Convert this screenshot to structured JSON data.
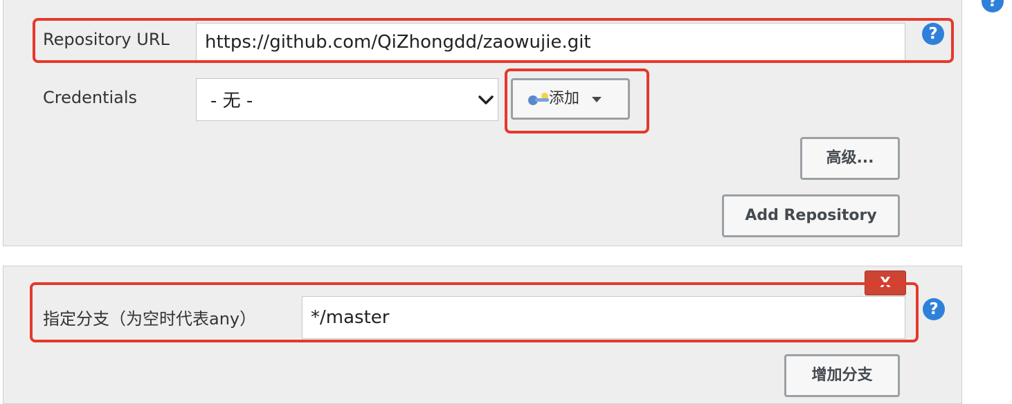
{
  "repository": {
    "url_label": "Repository URL",
    "url_value": "https://github.com/QiZhongdd/zaowujie.git",
    "credentials_label": "Credentials",
    "credentials_selected": "- 无 -",
    "add_button_label": "添加",
    "advanced_button_label": "高级...",
    "add_repository_label": "Add Repository"
  },
  "branch": {
    "label": "指定分支（为空时代表any）",
    "value": "*/master",
    "delete_label": "X",
    "add_branch_label": "增加分支"
  },
  "help": {
    "glyph": "?"
  },
  "colors": {
    "highlight": "#e4392b",
    "help_blue": "#2f80d9",
    "delete_red": "#cc4433",
    "panel_bg": "#eeeeee"
  }
}
